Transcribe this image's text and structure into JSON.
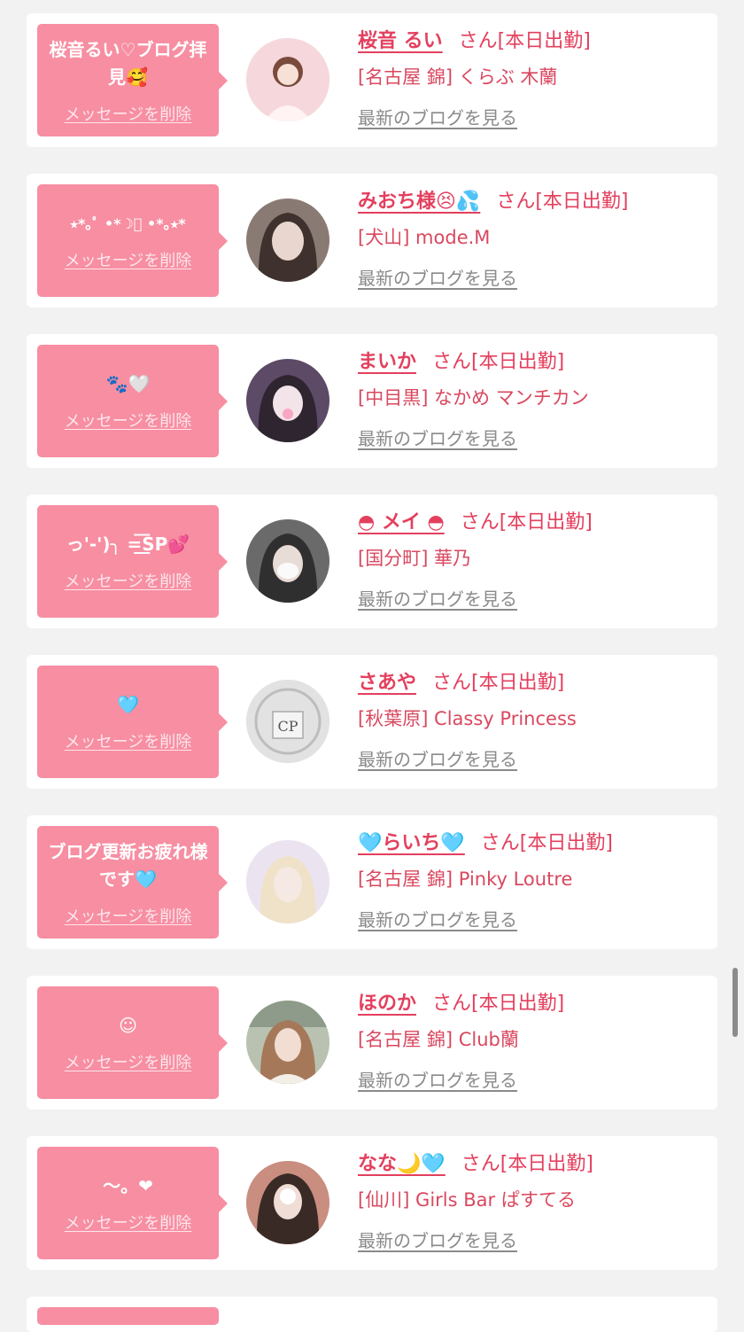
{
  "common": {
    "delete_label": "メッセージを削除",
    "blog_label": "最新のブログを見る",
    "san_label": "さん[本日出勤]"
  },
  "entries": [
    {
      "message": "桜音るい♡ブログ拝見🥰",
      "name": "桜音 るい",
      "shop": "[名古屋 錦] くらぶ 木蘭",
      "avatar": "avatar-1"
    },
    {
      "message": "⭑*｡ﾟ •*☽ﾟ •*｡⭑*",
      "name": "みおち様😣💦",
      "shop": "[犬山] mode.M",
      "avatar": "avatar-2"
    },
    {
      "message": "🐾🤍",
      "name": "まいか",
      "shop": "[中目黒] なかめ マンチカン",
      "avatar": "avatar-3"
    },
    {
      "message": "っ'-')╮ =͟͟͞͞SP💕",
      "name": "◓ メイ ◓",
      "shop": "[国分町] 華乃",
      "avatar": "avatar-4"
    },
    {
      "message": "🩵",
      "name": "さあや",
      "shop": "[秋葉原] Classy Princess",
      "avatar": "avatar-5"
    },
    {
      "message": "ブログ更新お疲れ様です🩵",
      "name": "🩵らいち🩵",
      "shop": "[名古屋 錦] Pinky Loutre",
      "avatar": "avatar-6"
    },
    {
      "message": "☺︎",
      "name": "ほのか",
      "shop": "[名古屋 錦] Club蘭",
      "avatar": "avatar-7"
    },
    {
      "message": "〜。❤",
      "name": "なな🌙🩵",
      "shop": "[仙川] Girls Bar ぱすてる",
      "avatar": "avatar-8"
    }
  ],
  "avatar_colors": [
    "#f4c9cf",
    "#5a4a45",
    "#6d5a7a",
    "#4a4a4a",
    "#d8d8d8",
    "#ece6ef",
    "#c8cfc0",
    "#7a6660"
  ]
}
